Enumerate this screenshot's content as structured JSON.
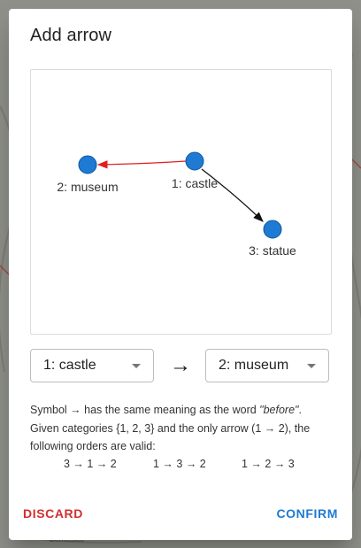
{
  "dialog": {
    "title": "Add arrow"
  },
  "graph": {
    "nodes": [
      {
        "label": "2: museum"
      },
      {
        "label": "1: castle"
      },
      {
        "label": "3: statue"
      }
    ],
    "colors": {
      "node_fill": "#1e7ad2",
      "highlight_edge": "#e02020",
      "edge": "#111111"
    }
  },
  "selectors": {
    "from_value": "1: castle",
    "arrow_symbol": "→",
    "to_value": "2: museum"
  },
  "explanation": {
    "line1_prefix": "Symbol → has the same meaning as the word ",
    "line1_emphasis": "\"before\"",
    "line1_suffix": ".",
    "line2": "Given categories {1, 2, 3} and the only arrow (1 → 2), the following orders are valid:"
  },
  "orders": [
    "3 → 1 → 2",
    "1 → 3 → 2",
    "1 → 2 → 3"
  ],
  "actions": {
    "discard_label": "DISCARD",
    "confirm_label": "CONFIRM"
  },
  "background_fragments": [
    "Cernosice"
  ]
}
